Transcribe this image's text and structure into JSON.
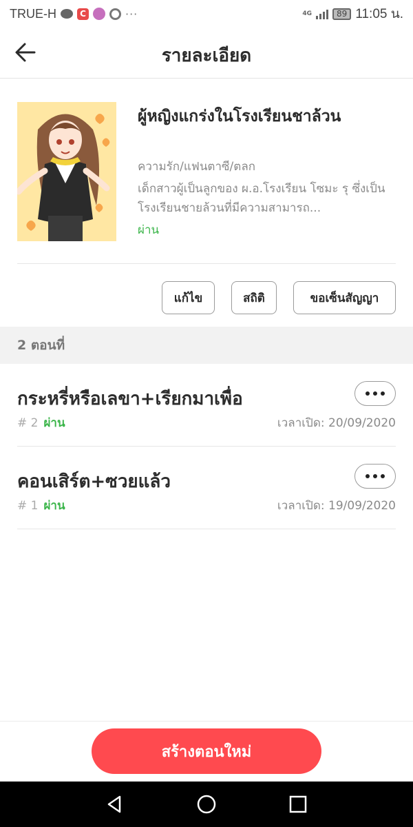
{
  "status_bar": {
    "carrier": "TRUE-H",
    "battery": "89",
    "network": "4G",
    "time": "11:05 น.",
    "more": "···"
  },
  "header": {
    "title": "รายละเอียด"
  },
  "book": {
    "title": "ผู้หญิงแกร่งในโรงเรียนชาล้วน",
    "genre": "ความรัก/แฟนตาซี/ตลก",
    "description": "เด็กสาวผู้เป็นลูกของ ผ.อ.โรงเรียน โซมะ รุ ซึ่งเป็นโรงเรียนชายล้วนที่มีความสามารถ...",
    "status": "ผ่าน"
  },
  "actions": {
    "edit_label": "แก้ไข",
    "stats_label": "สถิติ",
    "contract_label": "ขอเซ็นสัญญา"
  },
  "episodes_section": {
    "heading": "2 ตอนที่"
  },
  "episodes": [
    {
      "title": "กระหรี่หรือเลขา+เรียกมาเพื่อ",
      "number": "# 2",
      "status": "ผ่าน",
      "date": "เวลาเปิด: 20/09/2020"
    },
    {
      "title": "คอนเสิร์ต+ซวยแล้ว",
      "number": "# 1",
      "status": "ผ่าน",
      "date": "เวลาเปิด: 19/09/2020"
    }
  ],
  "bottom": {
    "create_label": "สร้างตอนใหม่"
  },
  "colors": {
    "accent": "#ff4a4f",
    "pass_green": "#3bb54a"
  }
}
